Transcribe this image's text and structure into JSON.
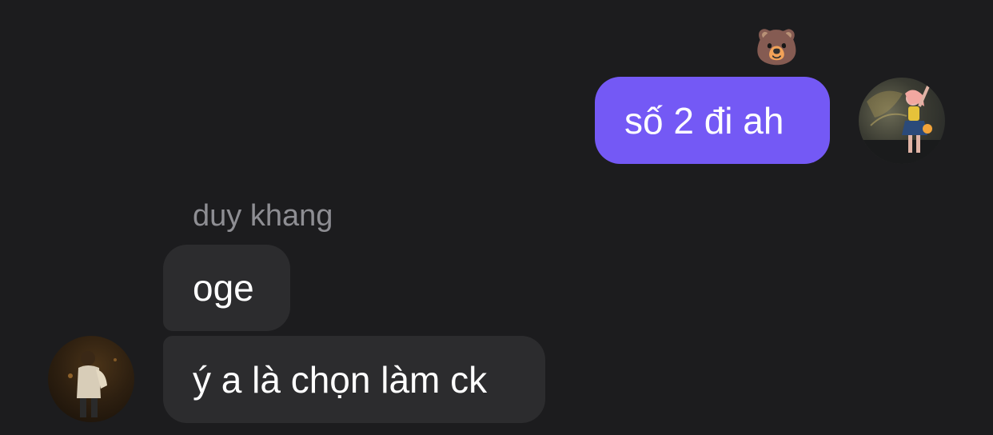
{
  "thread": {
    "outgoing": {
      "reaction": "🐻‍❄️",
      "reaction_fallback": "🐻",
      "text": "số 2 đi ah",
      "avatar_icon": "user-avatar-photo-icon"
    },
    "incoming": {
      "sender_name": "duy khang",
      "messages": [
        {
          "text": "oge"
        },
        {
          "text": "ý a là chọn làm ck"
        }
      ],
      "avatar_icon": "sender-avatar-photo-icon"
    }
  },
  "colors": {
    "background": "#1c1c1e",
    "outgoing_bubble": "#7459f5",
    "incoming_bubble": "#2c2c2e",
    "sender_name": "#8e8e93",
    "text": "#ffffff"
  }
}
